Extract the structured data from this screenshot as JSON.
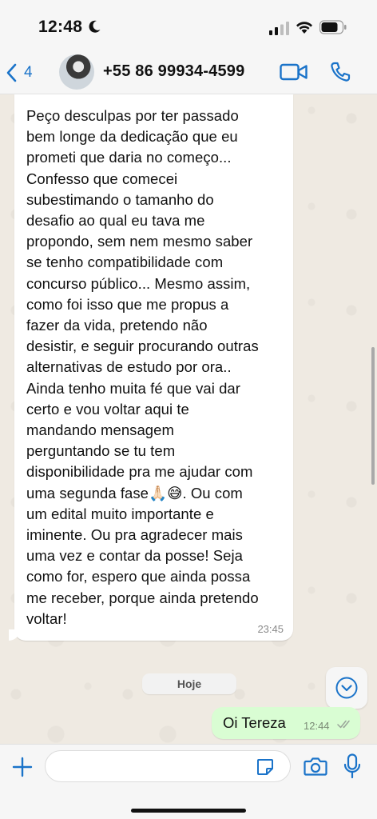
{
  "status_bar": {
    "time": "12:48"
  },
  "header": {
    "back_count": "4",
    "contact_name": "+55 86 99934-4599"
  },
  "messages": {
    "incoming": {
      "text": "Peço desculpas por ter passado\nbem longe da dedicação que eu\nprometi que daria no começo...\nConfesso que comecei\nsubestimando o tamanho do\ndesafio ao qual eu tava me\npropondo, sem nem mesmo saber\nse tenho compatibilidade com\nconcurso público... Mesmo assim,\ncomo foi isso que me propus a\nfazer da vida, pretendo não\ndesistir, e seguir procurando outras\nalternativas de estudo por ora..\nAinda tenho muita fé que vai dar\ncerto e vou voltar aqui te\nmandando mensagem\nperguntando se tu tem\ndisponibilidade pra me ajudar com\numa segunda fase🙏🏻😅. Ou com\num edital muito importante e\niminente. Ou pra agradecer mais\numa vez e contar da posse! Seja\ncomo for, espero que ainda possa\nme receber, porque ainda pretendo\nvoltar!",
      "time": "23:45"
    },
    "date_divider": "Hoje",
    "outgoing": {
      "text": "Oi Tereza",
      "time": "12:44",
      "status": "read"
    }
  },
  "input_bar": {
    "value": ""
  },
  "colors": {
    "accent": "#1a73c9",
    "outgoing_bubble": "#d9fdd3",
    "chat_background": "#efeae2"
  }
}
